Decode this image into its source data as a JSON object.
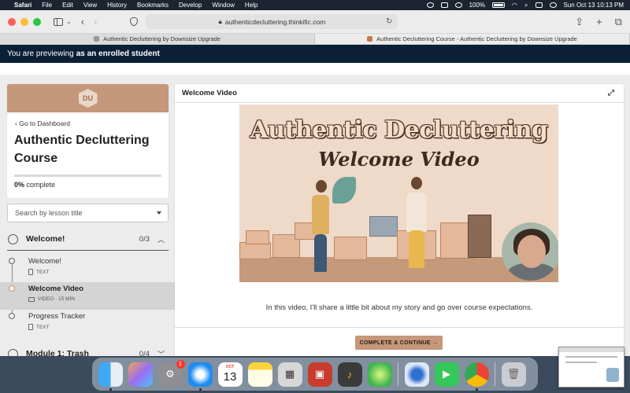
{
  "menubar": {
    "app_name": "Safari",
    "menus": [
      "File",
      "Edit",
      "View",
      "History",
      "Bookmarks",
      "Develop",
      "Window",
      "Help"
    ],
    "battery": "100%",
    "datetime": "Sun Oct 13  10:13 PM"
  },
  "browser": {
    "url": "authenticdecluttering.thinkific.com",
    "tabs": [
      {
        "title": "Authentic Decluttering by Downsize Upgrade"
      },
      {
        "title": "Authentic Decluttering Course - Authentic Decluttering by Downsize Upgrade"
      }
    ]
  },
  "banner": {
    "prefix": "You are previewing",
    "role": "as an enrolled student"
  },
  "course": {
    "logo_text": "DU",
    "back_label": "Go to Dashboard",
    "title": "Authentic Decluttering Course",
    "progress_percent": 0,
    "progress_value": "0%",
    "progress_suffix": "complete",
    "search_placeholder": "Search by lesson title",
    "chapters": [
      {
        "title": "Welcome!",
        "count": "0/3"
      },
      {
        "title": "Module 1: Trash",
        "count": "0/4"
      }
    ],
    "lessons": [
      {
        "title": "Welcome!",
        "meta": "TEXT"
      },
      {
        "title": "Welcome Video",
        "meta": "VIDEO · 15 MIN"
      },
      {
        "title": "Progress Tracker",
        "meta": "TEXT"
      }
    ]
  },
  "lesson": {
    "header": "Welcome Video",
    "thumb_title": "Authentic Decluttering",
    "thumb_subtitle": "Welcome Video",
    "description": "In this video, I'll share a little bit about my story and go over course expectations.",
    "complete_button": "COMPLETE & CONTINUE →"
  },
  "dock": {
    "settings_badge": "1",
    "calendar_month": "OCT",
    "calendar_day": "13"
  },
  "colors": {
    "accent": "#c5977b",
    "banner_bg": "#0b1f36"
  }
}
